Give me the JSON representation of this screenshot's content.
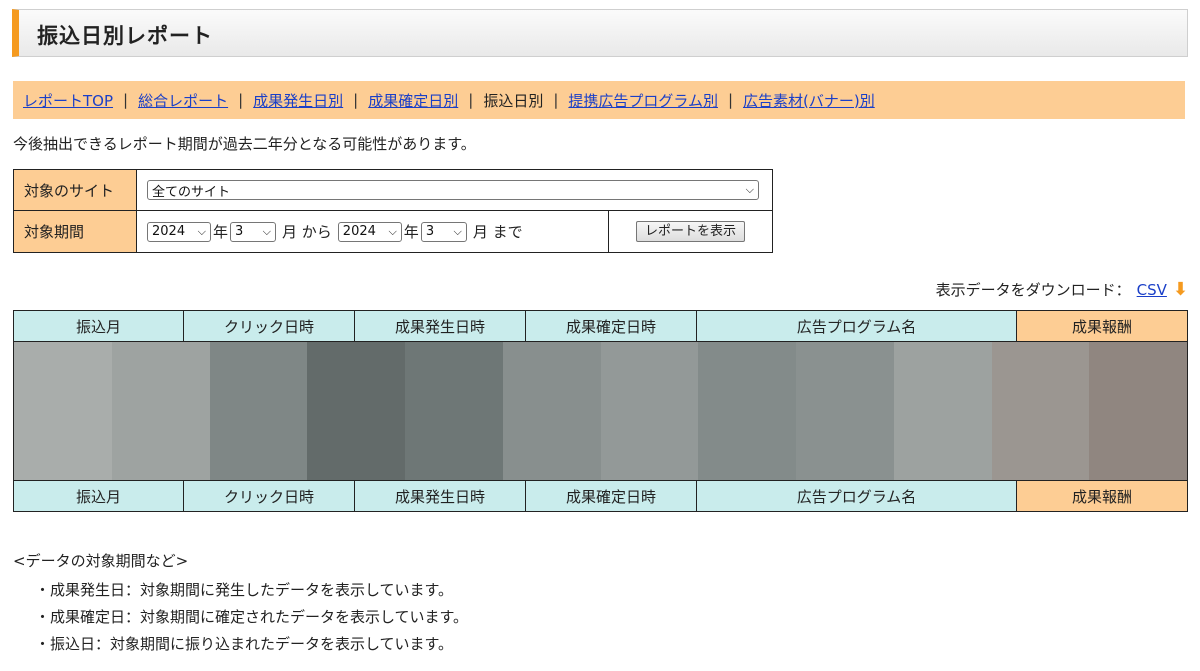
{
  "page": {
    "title": "振込日別レポート"
  },
  "nav": {
    "items": [
      {
        "label": "レポートTOP",
        "link": true
      },
      {
        "label": "総合レポート",
        "link": true
      },
      {
        "label": "成果発生日別",
        "link": true
      },
      {
        "label": "成果確定日別",
        "link": true
      },
      {
        "label": "振込日別",
        "link": false
      },
      {
        "label": "提携広告プログラム別",
        "link": true
      },
      {
        "label": "広告素材(バナー)別",
        "link": true
      }
    ],
    "separator": "|"
  },
  "notice": "今後抽出できるレポート期間が過去二年分となる可能性があります。",
  "form": {
    "site_label": "対象のサイト",
    "site_value": "全てのサイト",
    "period_label": "対象期間",
    "from_year": "2024",
    "from_month": "3",
    "to_year": "2024",
    "to_month": "3",
    "year_unit": "年",
    "month_from_text": "月 から",
    "month_to_text": "月 まで",
    "submit_label": "レポートを表示"
  },
  "download": {
    "label": "表示データをダウンロード：",
    "link": "CSV"
  },
  "table": {
    "columns": [
      "振込月",
      "クリック日時",
      "成果発生日時",
      "成果確定日時",
      "広告プログラム名",
      "成果報酬"
    ]
  },
  "notes": {
    "heading": "<データの対象期間など>",
    "items": [
      "・成果発生日：対象期間に発生したデータを表示しています。",
      "・成果確定日：対象期間に確定されたデータを表示しています。",
      "・振込日：対象期間に振り込まれたデータを表示しています。"
    ]
  },
  "colors": {
    "accent": "#f59a1f",
    "nav_bg": "#fdcd94",
    "header_bg": "#c9ecec",
    "link": "#1a3fc8"
  }
}
